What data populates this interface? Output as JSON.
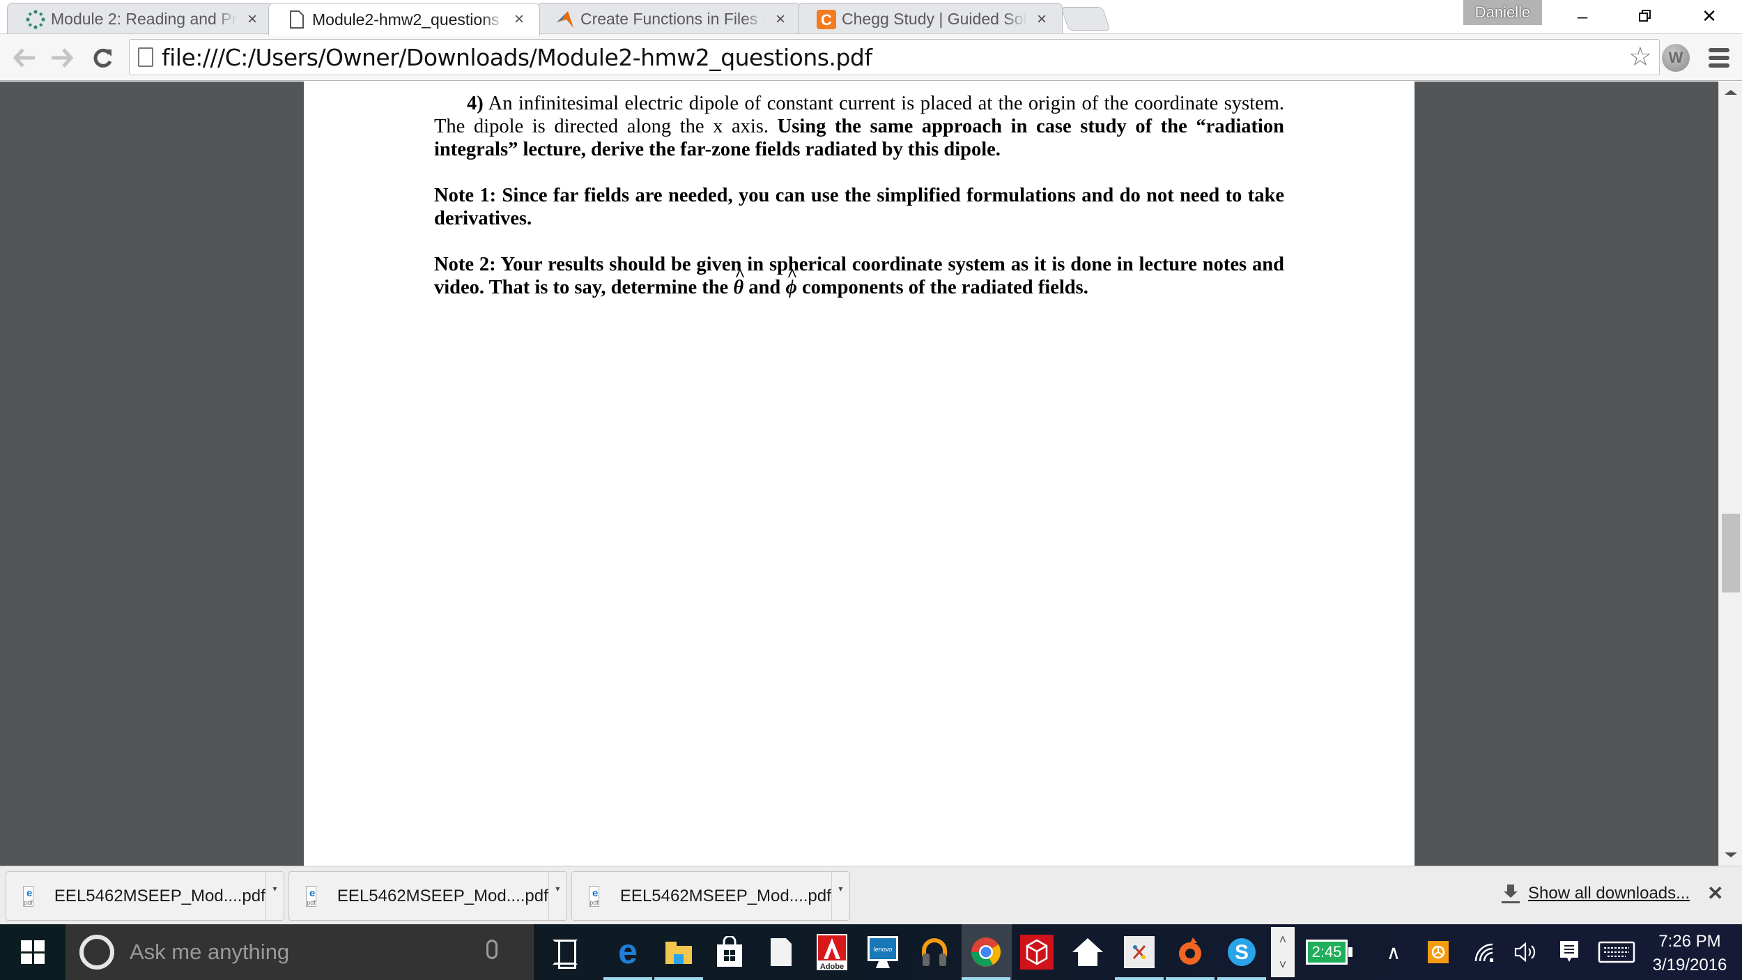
{
  "window": {
    "profile_name": "Danielle",
    "minimize_glyph": "–",
    "restore_glyph": "❐",
    "close_glyph": "✕"
  },
  "tabs": [
    {
      "title": "Module 2: Reading and Pr",
      "favicon": "canvas-icon",
      "active": false
    },
    {
      "title": "Module2-hmw2_questions",
      "favicon": "page-icon",
      "active": true
    },
    {
      "title": "Create Functions in Files -",
      "favicon": "matlab-icon",
      "active": false
    },
    {
      "title": "Chegg Study | Guided Sol",
      "favicon": "chegg-icon",
      "active": false
    }
  ],
  "tab_close_glyph": "×",
  "toolbar": {
    "back_glyph": "⇦",
    "forward_glyph": "⇨",
    "reload_glyph": "C",
    "url": "file:///C:/Users/Owner/Downloads/Module2-hmw2_questions.pdf",
    "star_glyph": "☆",
    "extension_label": "W"
  },
  "document": {
    "q_number": "4)",
    "q_text_plain": "An infinitesimal electric dipole of constant current is placed at the origin of the coordinate system. The dipole is directed along the x axis.",
    "q_text_bold": "Using the same approach in case study of the “radiation integrals” lecture, derive the far-zone fields radiated by this dipole.",
    "note1": "Note 1: Since far fields are needed, you can use the simplified formulations and do not need to take derivatives.",
    "note2_a": "Note 2: Your results should be given in spherical coordinate system as it is done in lecture notes and video. That is to say, determine the",
    "theta_symbol": "θ",
    "note2_and": "and",
    "phi_symbol": "ϕ",
    "note2_b": "components of the radiated fields."
  },
  "scrollbar": {
    "position_fraction": 0.62
  },
  "downloads": {
    "items": [
      {
        "name": "EEL5462MSEEP_Mod....pdf",
        "icon_label": "pdf"
      },
      {
        "name": "EEL5462MSEEP_Mod....pdf",
        "icon_label": "pdf"
      },
      {
        "name": "EEL5462MSEEP_Mod....pdf",
        "icon_label": "pdf"
      }
    ],
    "arrow_glyph": "▾",
    "show_all": "Show all downloads...",
    "close_glyph": "✕"
  },
  "taskbar": {
    "search_placeholder": "Ask me anything",
    "pinned": [
      {
        "name": "edge",
        "glyph": "e",
        "color": "#1e7fd8"
      },
      {
        "name": "file-explorer",
        "glyph": "📁",
        "color": "#f3c74d"
      },
      {
        "name": "store",
        "glyph": "🛍",
        "color": "#ffffff"
      },
      {
        "name": "blank-file",
        "glyph": "📄",
        "color": "#ffffff"
      },
      {
        "name": "adobe",
        "glyph": "A",
        "color": "#d7191c"
      },
      {
        "name": "lenovo",
        "glyph": "lenovo",
        "color": "#1878b8"
      },
      {
        "name": "google-play-music",
        "glyph": "🎧",
        "color": "#f39c12"
      },
      {
        "name": "chrome",
        "glyph": "●",
        "color": "#4285f4"
      },
      {
        "name": "red-app",
        "glyph": "⬡",
        "color": "#d0121b"
      },
      {
        "name": "home",
        "glyph": "⌂",
        "color": "#ffffff"
      },
      {
        "name": "paint-app",
        "glyph": "✖",
        "color": "#e9e9e9"
      },
      {
        "name": "origin",
        "glyph": "◉",
        "color": "#f26522"
      },
      {
        "name": "skype",
        "glyph": "S",
        "color": "#2aa4e8"
      }
    ],
    "battery_time": "2:45",
    "tray_up": "˄",
    "tray_down": "˅",
    "tray_chevron": "∧",
    "volume_glyph": "🔉",
    "time": "7:26 PM",
    "date": "3/19/2016"
  }
}
